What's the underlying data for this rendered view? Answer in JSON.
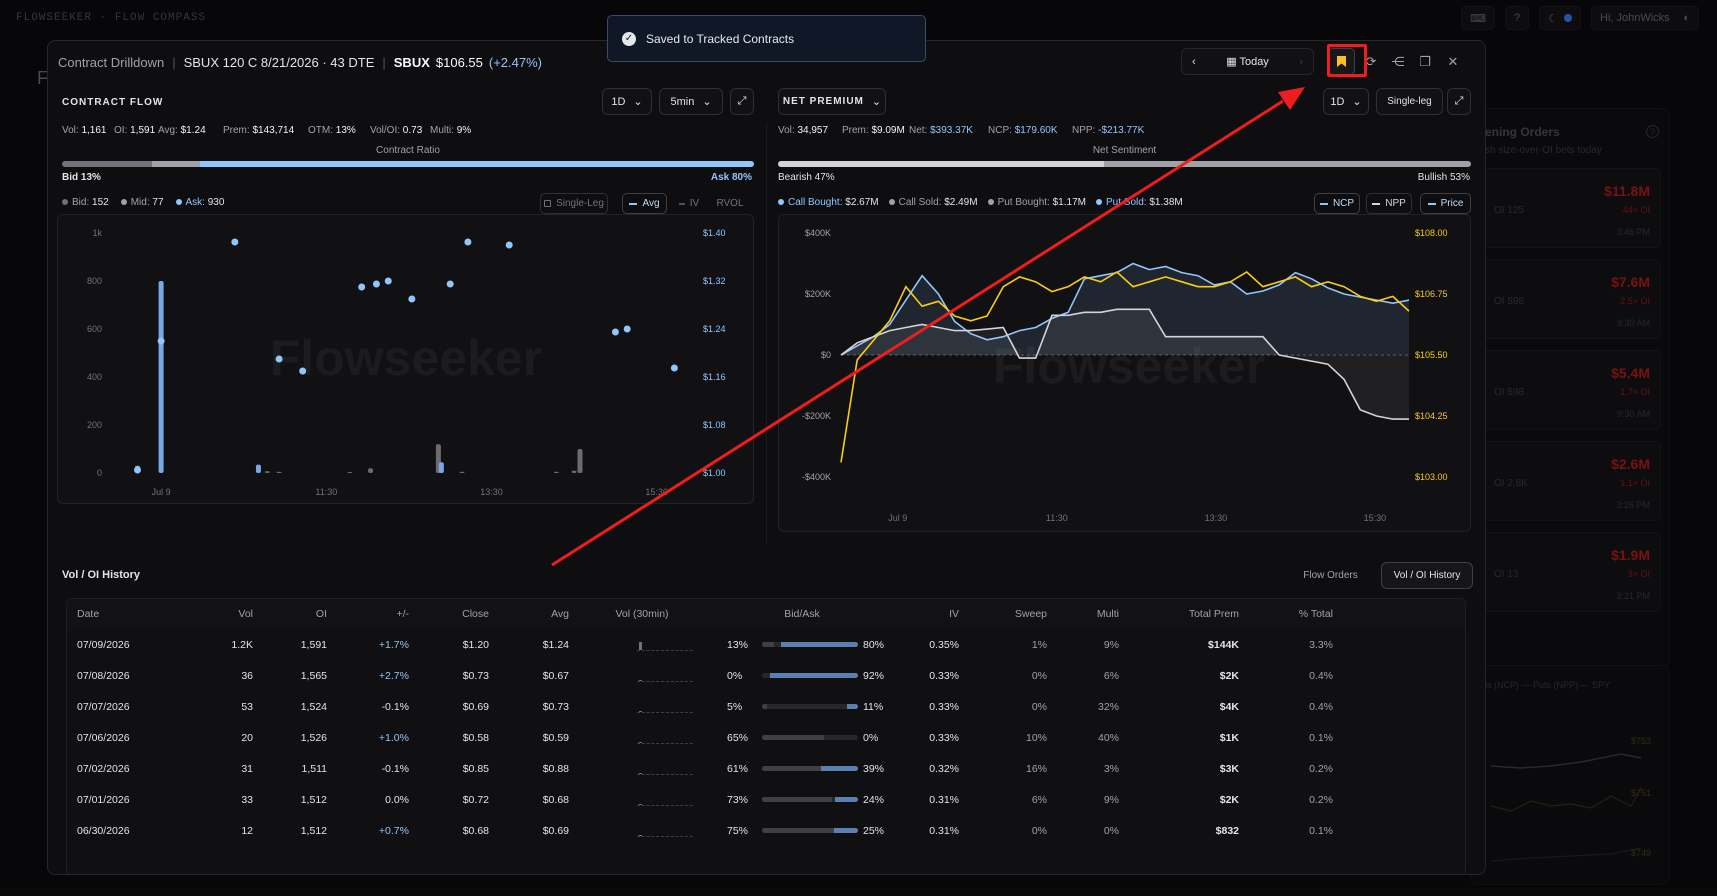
{
  "app": {
    "title": "FLOWSEEKER · FLOW COMPASS",
    "greeting": "Hi, JohnWicks"
  },
  "side": {
    "title": "ening Orders",
    "subtitle": "sh size-over-OI bets today",
    "cards": [
      {
        "val": "$11.8M",
        "x": "44× OI",
        "oi": "OI 125",
        "t": "3:46 PM"
      },
      {
        "val": "$7.6M",
        "x": "2.5× OI",
        "oi": "OI 598",
        "t": "9:30 AM"
      },
      {
        "val": "$5.4M",
        "x": "1.7× OI",
        "oi": "OI 598",
        "t": "9:30 AM"
      },
      {
        "val": "$2.6M",
        "x": "1.1× OI",
        "oi": "OI 2.8K",
        "t": "3:26 PM"
      },
      {
        "val": "$1.9M",
        "x": "3× OI",
        "oi": "OI 13",
        "t": "3:21 PM"
      }
    ],
    "legend": "ls (NCP) — Puts (NPP) — SPY",
    "prices": [
      "$753",
      "$751",
      "$749"
    ]
  },
  "modal": {
    "section": "Contract Drilldown",
    "contract": "SBUX 120 C 8/21/2026 · 43 DTE",
    "ticker": "SBUX",
    "price": "$106.55",
    "change": "(+2.47%)",
    "date_label": "Today"
  },
  "toast": {
    "message": "Saved to Tracked Contracts"
  },
  "flow": {
    "title": "CONTRACT FLOW",
    "range": "1D",
    "interval": "5min",
    "stats": [
      {
        "k": "Vol:",
        "v": "1,161"
      },
      {
        "k": "OI:",
        "v": "1,591"
      },
      {
        "k": "Avg:",
        "v": "$1.24"
      },
      {
        "k": "Prem:",
        "v": "$143,714"
      },
      {
        "k": "OTM:",
        "v": "13%"
      },
      {
        "k": "Vol/OI:",
        "v": "0.73"
      },
      {
        "k": "Multi:",
        "v": "9%"
      }
    ],
    "ratio_label": "Contract Ratio",
    "bid_label": "Bid 13%",
    "ask_label": "Ask 80%",
    "bid_pct": 13,
    "mid_pct": 7,
    "ask_pct": 80,
    "legend": [
      {
        "k": "Bid:",
        "v": "152"
      },
      {
        "k": "Mid:",
        "v": "77"
      },
      {
        "k": "Ask:",
        "v": "930"
      }
    ],
    "chips": [
      "Single-Leg",
      "Avg",
      "IV",
      "RVOL"
    ],
    "watermark": "Flowseeker"
  },
  "premium": {
    "title": "NET PREMIUM",
    "range": "1D",
    "mode": "Single-leg",
    "stats": [
      {
        "k": "Vol:",
        "v": "34,957",
        "c": ""
      },
      {
        "k": "Prem:",
        "v": "$9.09M",
        "c": ""
      },
      {
        "k": "Net:",
        "v": "$393.37K",
        "c": "blu"
      },
      {
        "k": "NCP:",
        "v": "$179.60K",
        "c": "blu"
      },
      {
        "k": "NPP:",
        "v": "-$213.77K",
        "c": "blu"
      }
    ],
    "ratio_label": "Net Sentiment",
    "bear_label": "Bearish 47%",
    "bull_label": "Bullish 53%",
    "bear_pct": 47,
    "bull_pct": 53,
    "legend": [
      {
        "k": "Call Bought:",
        "v": "$2.67M",
        "color": "#93c5fd"
      },
      {
        "k": "Call Sold:",
        "v": "$2.49M",
        "color": "#a1a1aa"
      },
      {
        "k": "Put Bought:",
        "v": "$1.17M",
        "color": "#a1a1aa"
      },
      {
        "k": "Put Sold:",
        "v": "$1.38M",
        "color": "#93c5fd"
      }
    ],
    "chips": [
      "NCP",
      "NPP",
      "Price"
    ],
    "watermark": "Flowseeker"
  },
  "chart_data": [
    {
      "type": "bar",
      "title": "",
      "x_ticks": [
        "Jul 9",
        "11:30",
        "13:30",
        "15:30"
      ],
      "y_ticks": [
        "1k",
        "800",
        "600",
        "400",
        "200",
        "0"
      ],
      "y2_ticks": [
        "$1.40",
        "$1.32",
        "$1.24",
        "$1.16",
        "$1.08",
        "$1.00"
      ],
      "ylim": [
        0,
        1000
      ],
      "y2lim": [
        1.0,
        1.4
      ],
      "bars": [
        {
          "x": 0.05,
          "v": 30,
          "c": "blue"
        },
        {
          "x": 0.09,
          "v": 800,
          "c": "blue"
        },
        {
          "x": 0.255,
          "v": 35,
          "c": "blue"
        },
        {
          "x": 0.27,
          "v": 8,
          "c": "gray"
        },
        {
          "x": 0.29,
          "v": 5,
          "c": "gray"
        },
        {
          "x": 0.41,
          "v": 4,
          "c": "gray"
        },
        {
          "x": 0.445,
          "v": 20,
          "c": "gray"
        },
        {
          "x": 0.56,
          "v": 120,
          "c": "gray"
        },
        {
          "x": 0.565,
          "v": 45,
          "c": "blue"
        },
        {
          "x": 0.6,
          "v": 5,
          "c": "gray"
        },
        {
          "x": 0.76,
          "v": 5,
          "c": "gray"
        },
        {
          "x": 0.79,
          "v": 10,
          "c": "gray"
        },
        {
          "x": 0.8,
          "v": 100,
          "c": "gray"
        }
      ],
      "price_points": [
        {
          "x": 0.05,
          "y": 1.005
        },
        {
          "x": 0.09,
          "y": 1.22
        },
        {
          "x": 0.215,
          "y": 1.385
        },
        {
          "x": 0.29,
          "y": 1.19
        },
        {
          "x": 0.33,
          "y": 1.17
        },
        {
          "x": 0.43,
          "y": 1.31
        },
        {
          "x": 0.455,
          "y": 1.315
        },
        {
          "x": 0.475,
          "y": 1.32
        },
        {
          "x": 0.515,
          "y": 1.29
        },
        {
          "x": 0.58,
          "y": 1.315
        },
        {
          "x": 0.61,
          "y": 1.385
        },
        {
          "x": 0.68,
          "y": 1.38
        },
        {
          "x": 0.86,
          "y": 1.235
        },
        {
          "x": 0.88,
          "y": 1.24
        },
        {
          "x": 0.96,
          "y": 1.175
        }
      ]
    },
    {
      "type": "line",
      "title": "",
      "x_ticks": [
        "Jul 9",
        "11:30",
        "13:30",
        "15:30"
      ],
      "y_ticks": [
        "$400K",
        "$200K",
        "$0",
        "-$200K",
        "-$400K"
      ],
      "y2_ticks": [
        "$108.00",
        "$106.75",
        "$105.50",
        "$104.25",
        "$103.00"
      ],
      "ylim": [
        -400000,
        400000
      ],
      "y2lim": [
        103.0,
        108.0
      ],
      "series": [
        {
          "name": "NCP",
          "values": [
            0,
            30,
            60,
            100,
            180,
            260,
            200,
            110,
            70,
            50,
            60,
            80,
            90,
            120,
            140,
            250,
            260,
            270,
            300,
            280,
            290,
            270,
            260,
            230,
            240,
            200,
            210,
            230,
            270,
            250,
            220,
            200,
            190,
            180,
            170,
            180
          ]
        },
        {
          "name": "NPP",
          "values": [
            0,
            40,
            60,
            80,
            90,
            100,
            90,
            80,
            80,
            85,
            90,
            -10,
            -10,
            130,
            130,
            140,
            140,
            150,
            150,
            150,
            60,
            60,
            60,
            60,
            60,
            60,
            60,
            0,
            -10,
            -20,
            -30,
            -80,
            -180,
            -200,
            -210,
            -210
          ]
        },
        {
          "name": "Price",
          "values": [
            103.3,
            105.4,
            105.8,
            106.2,
            106.9,
            106.5,
            106.6,
            106.3,
            106.2,
            106.3,
            106.9,
            107.1,
            107.0,
            106.8,
            106.9,
            107.1,
            107.0,
            107.2,
            106.9,
            107.0,
            107.1,
            107.0,
            106.9,
            106.9,
            107.0,
            107.2,
            106.9,
            107.0,
            107.1,
            106.9,
            107.0,
            106.9,
            106.7,
            106.6,
            106.7,
            106.4
          ]
        }
      ]
    }
  ],
  "history": {
    "title": "Vol / OI History",
    "tabs": [
      "Flow Orders",
      "Vol / OI History"
    ],
    "headers": [
      "Date",
      "Vol",
      "OI",
      "+/-",
      "Close",
      "Avg",
      "Vol (30min)",
      "Bid/Ask",
      "IV",
      "Sweep",
      "Multi",
      "Total Prem",
      "% Total"
    ],
    "rows": [
      {
        "date": "07/09/2026",
        "vol": "1.2K",
        "oi": "1,591",
        "chg": "+1.7%",
        "pos": true,
        "close": "$1.20",
        "avg": "$1.24",
        "spark": 0.6,
        "bid": "13%",
        "ask": "80%",
        "bidp": 13,
        "askp": 80,
        "iv": "0.35%",
        "sweep": "1%",
        "multi": "9%",
        "prem": "$144K",
        "pct": "3.3%"
      },
      {
        "date": "07/08/2026",
        "vol": "36",
        "oi": "1,565",
        "chg": "+2.7%",
        "pos": true,
        "close": "$0.73",
        "avg": "$0.67",
        "spark": 0.05,
        "bid": "0%",
        "ask": "92%",
        "bidp": 0,
        "askp": 92,
        "iv": "0.33%",
        "sweep": "0%",
        "multi": "6%",
        "prem": "$2K",
        "pct": "0.4%"
      },
      {
        "date": "07/07/2026",
        "vol": "53",
        "oi": "1,524",
        "chg": "-0.1%",
        "pos": false,
        "close": "$0.69",
        "avg": "$0.73",
        "spark": 0.05,
        "bid": "5%",
        "ask": "11%",
        "bidp": 5,
        "askp": 11,
        "iv": "0.33%",
        "sweep": "0%",
        "multi": "32%",
        "prem": "$4K",
        "pct": "0.4%"
      },
      {
        "date": "07/06/2026",
        "vol": "20",
        "oi": "1,526",
        "chg": "+1.0%",
        "pos": true,
        "close": "$0.58",
        "avg": "$0.59",
        "spark": 0.05,
        "bid": "65%",
        "ask": "0%",
        "bidp": 65,
        "askp": 0,
        "iv": "0.33%",
        "sweep": "10%",
        "multi": "40%",
        "prem": "$1K",
        "pct": "0.1%"
      },
      {
        "date": "07/02/2026",
        "vol": "31",
        "oi": "1,511",
        "chg": "-0.1%",
        "pos": false,
        "close": "$0.85",
        "avg": "$0.88",
        "spark": 0.05,
        "bid": "61%",
        "ask": "39%",
        "bidp": 61,
        "askp": 39,
        "iv": "0.32%",
        "sweep": "16%",
        "multi": "3%",
        "prem": "$3K",
        "pct": "0.2%"
      },
      {
        "date": "07/01/2026",
        "vol": "33",
        "oi": "1,512",
        "chg": "0.0%",
        "pos": false,
        "close": "$0.72",
        "avg": "$0.68",
        "spark": 0.05,
        "bid": "73%",
        "ask": "24%",
        "bidp": 73,
        "askp": 24,
        "iv": "0.31%",
        "sweep": "6%",
        "multi": "9%",
        "prem": "$2K",
        "pct": "0.2%"
      },
      {
        "date": "06/30/2026",
        "vol": "12",
        "oi": "1,512",
        "chg": "+0.7%",
        "pos": true,
        "close": "$0.68",
        "avg": "$0.69",
        "spark": 0.05,
        "bid": "75%",
        "ask": "25%",
        "bidp": 75,
        "askp": 25,
        "iv": "0.31%",
        "sweep": "0%",
        "multi": "0%",
        "prem": "$832",
        "pct": "0.1%"
      }
    ]
  },
  "colors": {
    "accent": "#93c5fd",
    "price": "#facc15",
    "bookmark": "#fbbf24",
    "annotation": "#ef1d1d"
  }
}
